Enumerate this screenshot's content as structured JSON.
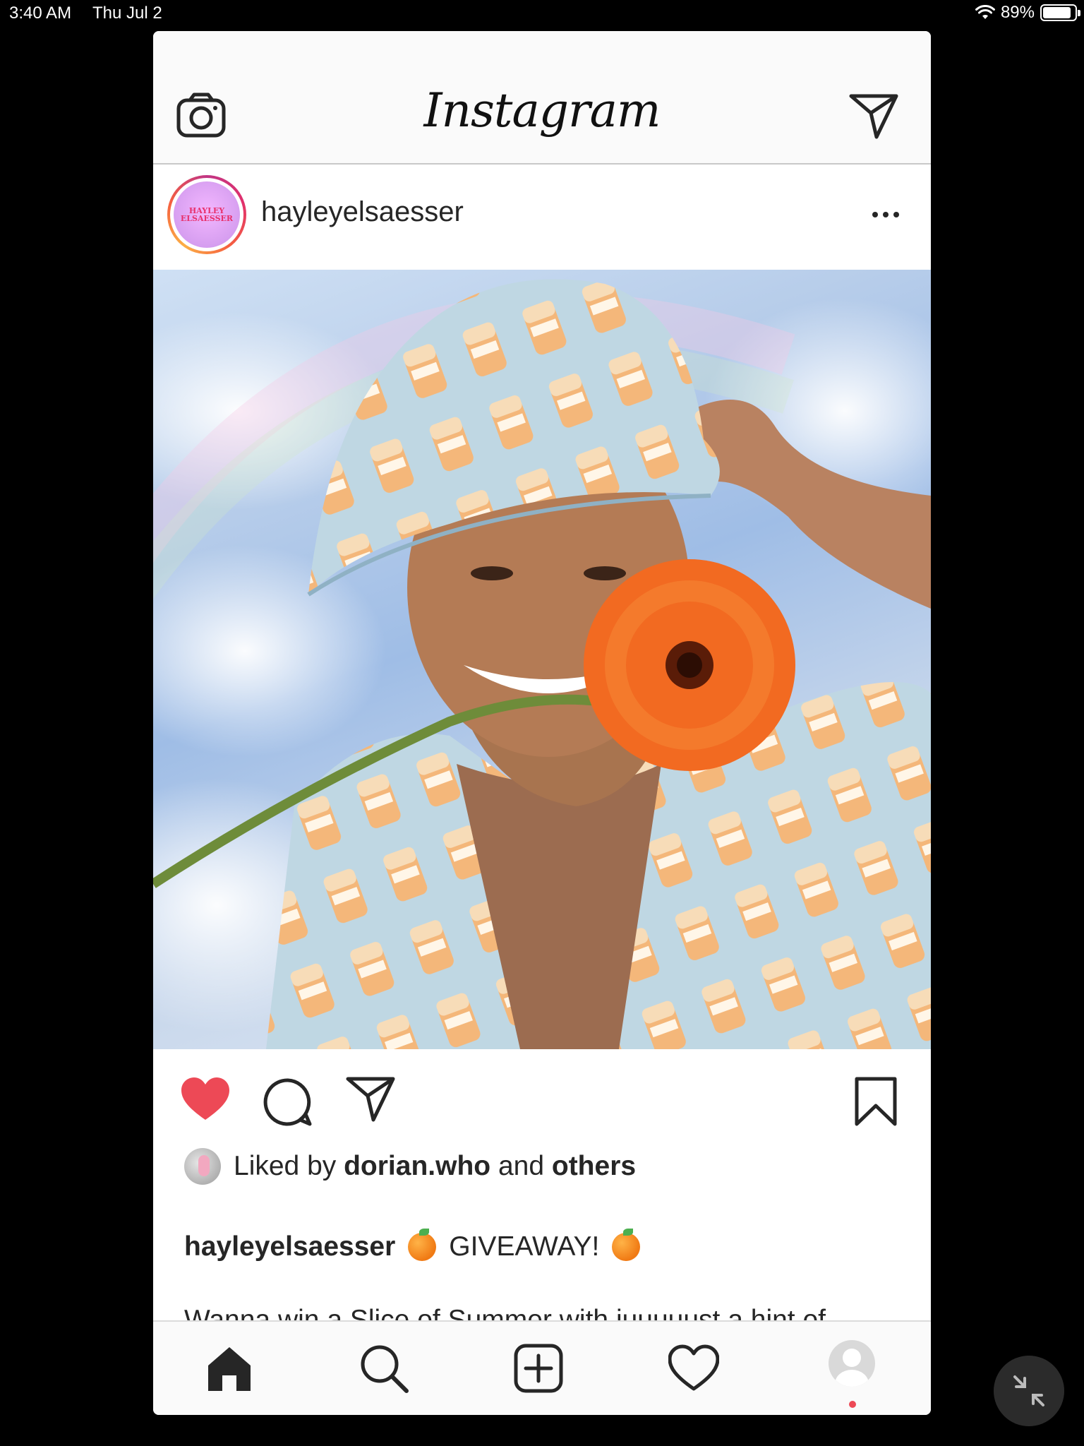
{
  "status_bar": {
    "time": "3:40 AM",
    "date": "Thu Jul 2",
    "battery_text": "89%",
    "battery_level": 0.89
  },
  "header": {
    "logo": "Instagram",
    "camera_icon": "camera-icon",
    "direct_icon": "paper-plane-icon"
  },
  "post": {
    "username": "hayleyelsaesser",
    "avatar_text_line1": "hayley",
    "avatar_text_line2": "elsaesser",
    "liked_prefix": "Liked by",
    "liked_user": "dorian.who",
    "liked_and": "and",
    "liked_others": "others",
    "caption_user": "hayleyelsaesser",
    "caption_title": "GIVEAWAY!",
    "caption_body": "Wanna win a Slice of Summer with juuuuust a hint of",
    "liked": true,
    "accent_like": "#ed4956"
  },
  "tabs": [
    "home-icon",
    "search-icon",
    "add-post-icon",
    "heart-icon",
    "profile-icon"
  ]
}
